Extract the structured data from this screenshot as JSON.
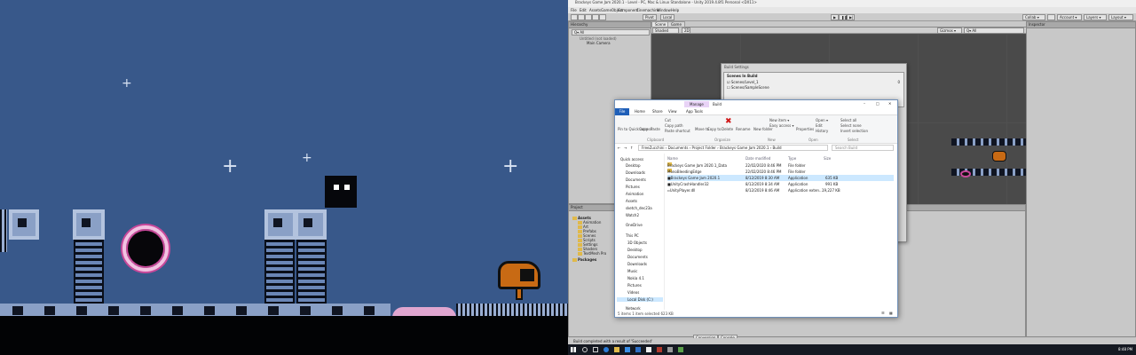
{
  "editor": {
    "title": "Brackeys Game Jam 2020.1 - Level - PC, Mac & Linux Standalone - Unity 2019.4.8f1 Personal <DX11>",
    "menu": [
      "File",
      "Edit",
      "Assets",
      "GameObject",
      "Component",
      "Cinemachine",
      "Window",
      "Help"
    ],
    "toolbar": {
      "pivot": "Pivot",
      "local": "Local",
      "collab": "Collab ▾",
      "account": "Account ▾",
      "layers": "Layers ▾",
      "layout": "Layout ▾"
    },
    "hierarchy": {
      "title": "Hierarchy",
      "search_placeholder": "Q▾ All",
      "scene": "Untitled (not loaded)",
      "item": "Main Camera"
    },
    "scene_tabs": {
      "scene": "Scene",
      "game": "Game",
      "shading": "Shaded",
      "mode": "2D",
      "gizmos": "Gizmos ▾",
      "gizmo_search": "Q▾ All"
    },
    "inspector": {
      "title": "Inspector"
    },
    "project": {
      "title": "Project",
      "assets_label": "Assets",
      "folders": [
        "Animation",
        "Art",
        "Prefabs",
        "Scenes",
        "Scripts",
        "Settings",
        "Shaders",
        "TextMesh Pro"
      ],
      "packages_label": "Packages"
    },
    "status": "Build completed with a result of 'Succeeded'",
    "bottom_tabs": [
      "Conversion",
      "Console"
    ]
  },
  "build_settings": {
    "title": "Build Settings",
    "section": "Scenes In Build",
    "scenes": [
      "Scenes/Level_1",
      "Scenes/SampleScene"
    ],
    "index": "0"
  },
  "explorer": {
    "title": "Build",
    "manage_tab": "Manage",
    "ribbon_tabs": [
      "File",
      "Home",
      "Share",
      "View",
      "App Tools"
    ],
    "ribbon": {
      "pin": "Pin to Quick access",
      "copy": "Copy",
      "paste": "Paste",
      "cut": "Cut",
      "copy_path": "Copy path",
      "paste_shortcut": "Paste shortcut",
      "move_to": "Move to",
      "copy_to": "Copy to",
      "delete": "Delete",
      "rename": "Rename",
      "new_folder": "New folder",
      "new_item": "New item ▾",
      "easy_access": "Easy access ▾",
      "properties": "Properties",
      "open": "Open ▾",
      "edit": "Edit",
      "history": "History",
      "select_all": "Select all",
      "select_none": "Select none",
      "invert_selection": "Invert selection",
      "groups": [
        "Clipboard",
        "Organize",
        "New",
        "Open",
        "Select"
      ]
    },
    "address": "FreeZucchini  ›  Documents  ›  Project Folder  ›  Brackeys Game Jam 2020.1  ›  Build",
    "search_placeholder": "Search Build",
    "sidebar": [
      "Quick access",
      "Desktop",
      "Downloads",
      "Documents",
      "Pictures",
      "Animation",
      "Assets",
      "sketch_dec23a",
      "Watch2",
      "OneDrive",
      "This PC",
      "3D Objects",
      "Desktop",
      "Documents",
      "Downloads",
      "Music",
      "Nokia 4.1",
      "Pictures",
      "Videos",
      "Local Disk (C:)",
      "Network"
    ],
    "columns": [
      "Name",
      "Date modified",
      "Type",
      "Size"
    ],
    "files": [
      {
        "name": "Brackeys Game Jam 2020.1_Data",
        "date": "22/02/2020 8:46 PM",
        "type": "File folder",
        "size": ""
      },
      {
        "name": "MonoBleedingEdge",
        "date": "22/02/2020 8:46 PM",
        "type": "File folder",
        "size": ""
      },
      {
        "name": "Brackeys Game Jam 2020.1",
        "date": "8/12/2019 8:30 AM",
        "type": "Application",
        "size": "635 KB"
      },
      {
        "name": "UnityCrashHandler32",
        "date": "8/12/2019 8:34 AM",
        "type": "Application",
        "size": "991 KB"
      },
      {
        "name": "UnityPlayer.dll",
        "date": "8/12/2019 8:46 AM",
        "type": "Application exten...",
        "size": "19,227 KB"
      }
    ],
    "status": "5 items     1 item selected  623 KB"
  },
  "taskbar": {
    "time": "8:48 PM"
  },
  "colors": {
    "game_sky": "#38588a",
    "portal_rim": "#c8489a",
    "cannon": "#c86a14",
    "editor_bg": "#c2c2c2",
    "selection": "#cce8ff"
  }
}
